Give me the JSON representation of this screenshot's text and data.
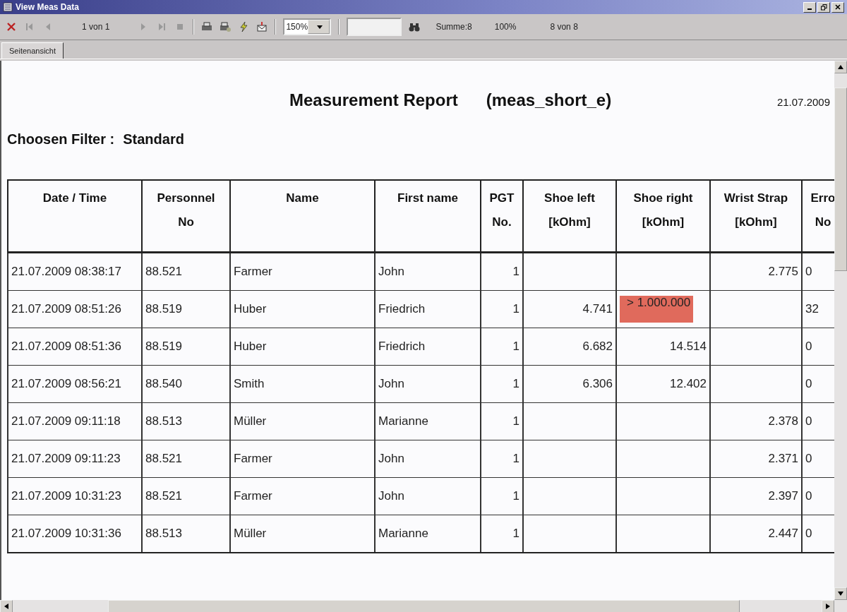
{
  "window": {
    "title": "View Meas Data"
  },
  "toolbar": {
    "page_indicator": "1 von 1",
    "zoom": "150%",
    "summary": "Summe:8",
    "percent": "100%",
    "record_count": "8 von 8"
  },
  "tabs": [
    {
      "label": "Seitenansicht",
      "selected": true
    }
  ],
  "report": {
    "title": "Measurement Report",
    "subtitle": "(meas_short_e)",
    "date": "21.07.2009",
    "filter_label": "Choosen Filter :",
    "filter_value": "Standard",
    "table": {
      "columns": [
        "Date / Time",
        "Personnel\nNo",
        "Name",
        "First name",
        "PGT\nNo.",
        "Shoe left\n[kOhm]",
        "Shoe right\n[kOhm]",
        "Wrist Strap\n[kOhm]",
        "Erro\nNo"
      ],
      "rows": [
        {
          "cells": [
            "21.07.2009  08:38:17",
            "88.521",
            "Farmer",
            "John",
            "1",
            "",
            "",
            "2.775",
            "0"
          ],
          "shoe_right_alarm": false
        },
        {
          "cells": [
            "21.07.2009  08:51:26",
            "88.519",
            "Huber",
            "Friedrich",
            "1",
            "4.741",
            "> 1.000.000",
            "",
            "32"
          ],
          "shoe_right_alarm": true
        },
        {
          "cells": [
            "21.07.2009  08:51:36",
            "88.519",
            "Huber",
            "Friedrich",
            "1",
            "6.682",
            "14.514",
            "",
            "0"
          ],
          "shoe_right_alarm": false
        },
        {
          "cells": [
            "21.07.2009  08:56:21",
            "88.540",
            "Smith",
            "John",
            "1",
            "6.306",
            "12.402",
            "",
            "0"
          ],
          "shoe_right_alarm": false
        },
        {
          "cells": [
            "21.07.2009  09:11:18",
            "88.513",
            "Müller",
            "Marianne",
            "1",
            "",
            "",
            "2.378",
            "0"
          ],
          "shoe_right_alarm": false
        },
        {
          "cells": [
            "21.07.2009  09:11:23",
            "88.521",
            "Farmer",
            "John",
            "1",
            "",
            "",
            "2.371",
            "0"
          ],
          "shoe_right_alarm": false
        },
        {
          "cells": [
            "21.07.2009  10:31:23",
            "88.521",
            "Farmer",
            "John",
            "1",
            "",
            "",
            "2.397",
            "0"
          ],
          "shoe_right_alarm": false
        },
        {
          "cells": [
            "21.07.2009  10:31:36",
            "88.513",
            "Müller",
            "Marianne",
            "1",
            "",
            "",
            "2.447",
            "0"
          ],
          "shoe_right_alarm": false
        }
      ]
    }
  }
}
